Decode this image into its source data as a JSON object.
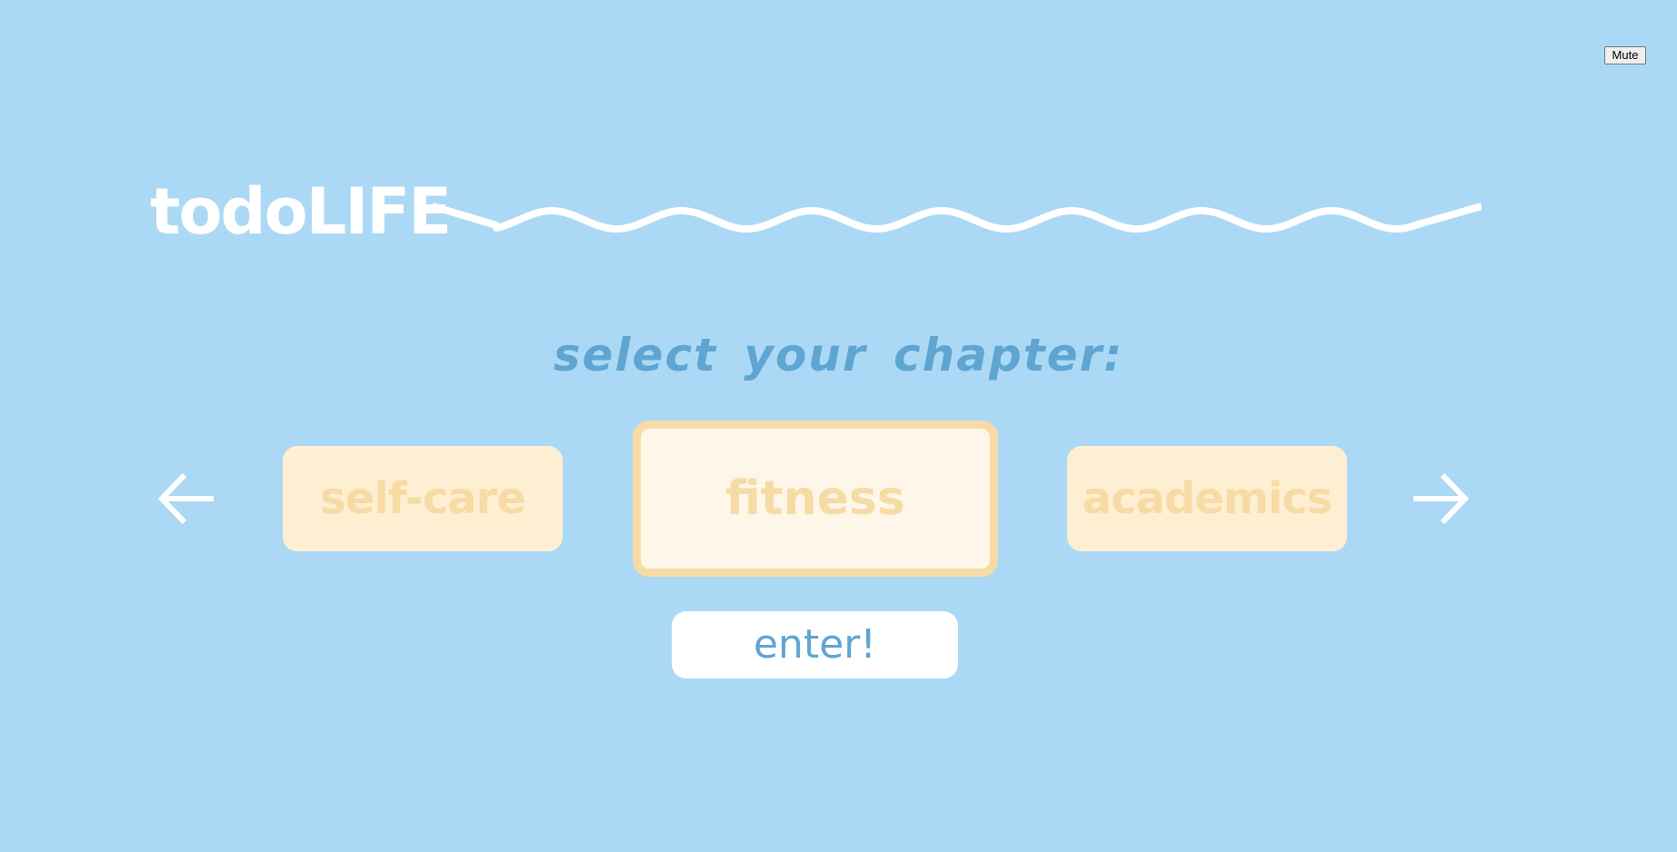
{
  "header": {
    "app_title": "todoLIFE",
    "mute_label": "Mute"
  },
  "main": {
    "subtitle": "select your chapter:",
    "chapters": [
      {
        "label": "self-care"
      },
      {
        "label": "fitness",
        "selected": true
      },
      {
        "label": "academics"
      }
    ],
    "enter_label": "enter!"
  },
  "icons": {
    "prev": "arrow-left-icon",
    "next": "arrow-right-icon",
    "decoration": "wave-icon"
  },
  "colors": {
    "background": "#abd9f5",
    "accent_text": "#5fa5d2",
    "card_text": "#f6dba4",
    "card_fill": "#feefd3",
    "selected_card_fill": "#fef6e8",
    "selected_card_border": "#f7dba6",
    "white": "#ffffff"
  }
}
